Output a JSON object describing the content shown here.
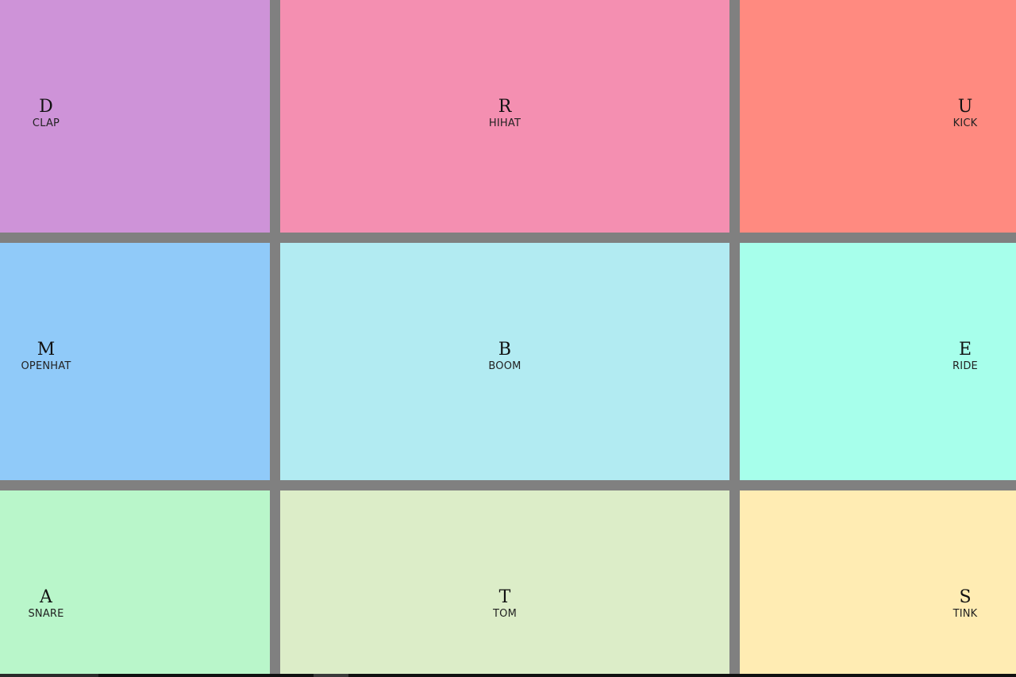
{
  "pads": [
    {
      "key": "D",
      "sound": "CLAP",
      "color": "#CE93D8"
    },
    {
      "key": "R",
      "sound": "HIHAT",
      "color": "#F48FB1"
    },
    {
      "key": "U",
      "sound": "KICK",
      "color": "#FF8A80"
    },
    {
      "key": "M",
      "sound": "OPENHAT",
      "color": "#90CAF9"
    },
    {
      "key": "B",
      "sound": "BOOM",
      "color": "#B2EBF2"
    },
    {
      "key": "E",
      "sound": "RIDE",
      "color": "#A7FFEB"
    },
    {
      "key": "A",
      "sound": "SNARE",
      "color": "#B9F6CA"
    },
    {
      "key": "T",
      "sound": "TOM",
      "color": "#DCEDC8"
    },
    {
      "key": "S",
      "sound": "TINK",
      "color": "#FFECB3"
    }
  ]
}
